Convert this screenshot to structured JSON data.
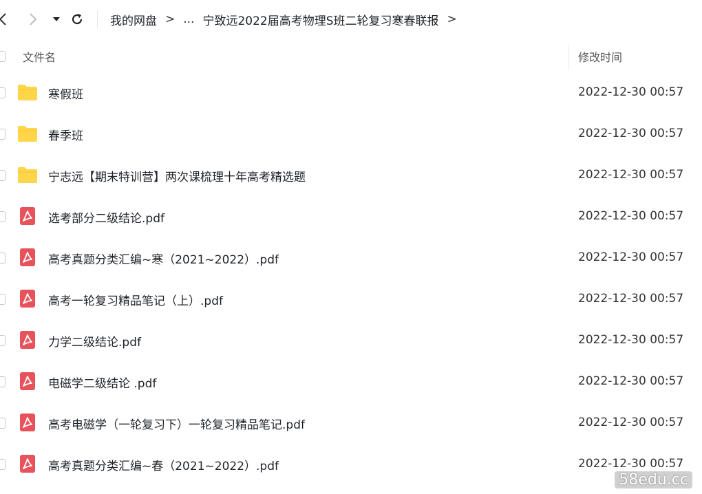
{
  "toolbar": {
    "back_icon": "chevron-left-icon",
    "forward_icon": "chevron-right-icon",
    "dropdown_icon": "caret-down-icon",
    "refresh_icon": "refresh-icon"
  },
  "breadcrumb": {
    "items": [
      "我的网盘",
      "...",
      "宁致远2022届高考物理S班二轮复习寒春联报"
    ],
    "separator": ">"
  },
  "columns": {
    "name": "文件名",
    "modified": "修改时间"
  },
  "files": [
    {
      "name": "寒假班",
      "type": "folder",
      "modified": "2022-12-30 00:57"
    },
    {
      "name": "春季班",
      "type": "folder",
      "modified": "2022-12-30 00:57"
    },
    {
      "name": "宁志远【期末特训营】两次课梳理十年高考精选题",
      "type": "folder",
      "modified": "2022-12-30 00:57"
    },
    {
      "name": "选考部分二级结论.pdf",
      "type": "pdf",
      "modified": "2022-12-30 00:57"
    },
    {
      "name": "高考真题分类汇编~寒（2021~2022）.pdf",
      "type": "pdf",
      "modified": "2022-12-30 00:57"
    },
    {
      "name": "高考一轮复习精品笔记（上）.pdf",
      "type": "pdf",
      "modified": "2022-12-30 00:57"
    },
    {
      "name": "力学二级结论.pdf",
      "type": "pdf",
      "modified": "2022-12-30 00:57"
    },
    {
      "name": "电磁学二级结论 .pdf",
      "type": "pdf",
      "modified": "2022-12-30 00:57"
    },
    {
      "name": "高考电磁学（一轮复习下）一轮复习精品笔记.pdf",
      "type": "pdf",
      "modified": "2022-12-30 00:57"
    },
    {
      "name": "高考真题分类汇编~春（2021~2022）.pdf",
      "type": "pdf",
      "modified": "2022-12-30 00:57"
    }
  ],
  "colors": {
    "folder": "#ffd54a",
    "pdf": "#e8525b"
  },
  "watermark": "58edu.cc"
}
